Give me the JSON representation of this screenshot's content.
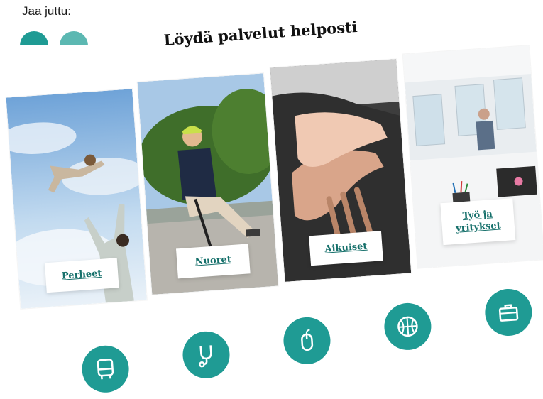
{
  "share": {
    "label": "Jaa juttu:"
  },
  "section": {
    "title": "Löydä palvelut helposti"
  },
  "cards": [
    {
      "label": "Perheet"
    },
    {
      "label": "Nuoret"
    },
    {
      "label": "Aikuiset"
    },
    {
      "label": "Työ ja yritykset"
    }
  ],
  "icons": [
    "bus-icon",
    "stethoscope-icon",
    "mouse-icon",
    "basketball-icon",
    "briefcase-icon"
  ],
  "colors": {
    "accent": "#1f9b94",
    "link": "#16706b"
  }
}
